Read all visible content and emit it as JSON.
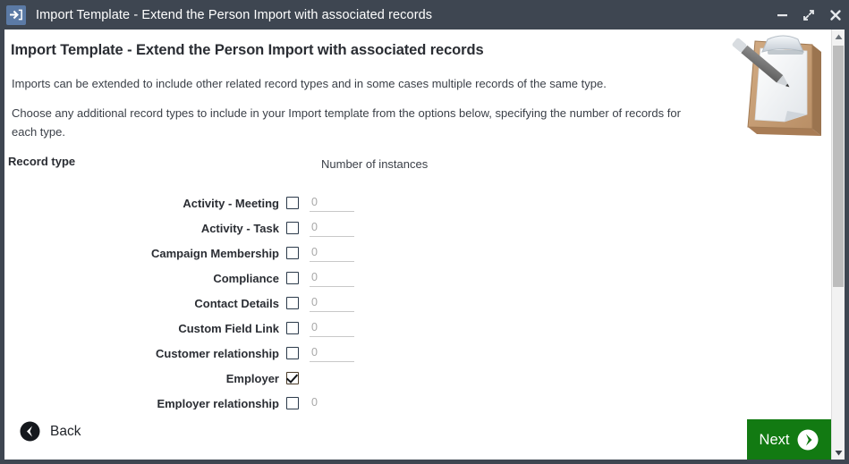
{
  "window": {
    "title": "Import Template - Extend the Person Import with associated records",
    "app_icon": "import-arrow-icon",
    "controls": {
      "minimize": "minimize-icon",
      "maximize": "maximize-icon",
      "close": "close-icon"
    }
  },
  "page": {
    "heading": "Import Template - Extend the Person Import with associated records",
    "paragraph1": "Imports can be extended to include other related record types and in some cases multiple records of the same type.",
    "paragraph2": "Choose any additional record types to include in your Import template from the options below, specifying the number of records for each type.",
    "illustration": "clipboard-with-pen-icon"
  },
  "table": {
    "header_record_type": "Record type",
    "header_instances": "Number of instances",
    "rows": [
      {
        "label": "Activity - Meeting",
        "checked": false,
        "has_input": true,
        "value": "",
        "placeholder": "0"
      },
      {
        "label": "Activity - Task",
        "checked": false,
        "has_input": true,
        "value": "",
        "placeholder": "0"
      },
      {
        "label": "Campaign Membership",
        "checked": false,
        "has_input": true,
        "value": "",
        "placeholder": "0"
      },
      {
        "label": "Compliance",
        "checked": false,
        "has_input": true,
        "value": "",
        "placeholder": "0"
      },
      {
        "label": "Contact Details",
        "checked": false,
        "has_input": true,
        "value": "",
        "placeholder": "0"
      },
      {
        "label": "Custom Field Link",
        "checked": false,
        "has_input": true,
        "value": "",
        "placeholder": "0"
      },
      {
        "label": "Customer relationship",
        "checked": false,
        "has_input": true,
        "value": "",
        "placeholder": "0"
      },
      {
        "label": "Employer",
        "checked": true,
        "has_input": false,
        "value": "",
        "placeholder": ""
      },
      {
        "label": "Employer relationship",
        "checked": false,
        "has_input": true,
        "value": "",
        "placeholder": "0"
      }
    ]
  },
  "footer": {
    "back_label": "Back",
    "back_icon": "chevron-left-circle-icon",
    "next_label": "Next",
    "next_icon": "chevron-right-circle-icon"
  },
  "colors": {
    "titlebar": "#3e4651",
    "next_button": "#127a12",
    "app_icon": "#5b7aa5",
    "text": "#2a2d33"
  },
  "scrollbar": {
    "up_icon": "scroll-up-arrow-icon",
    "down_icon": "scroll-down-arrow-icon"
  }
}
